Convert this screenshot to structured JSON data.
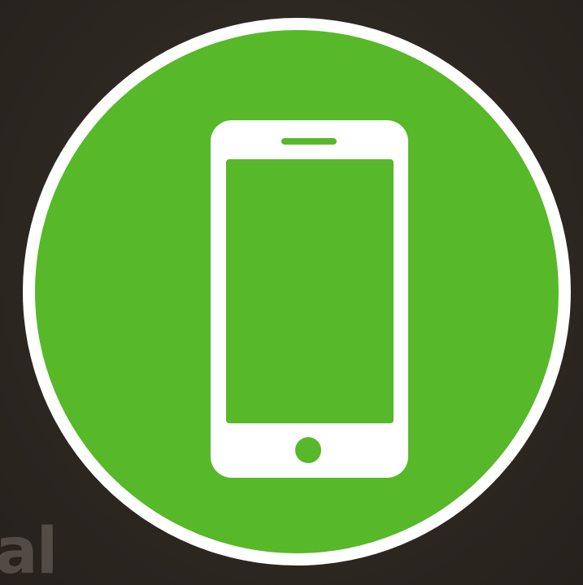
{
  "icon": {
    "name": "smartphone-icon",
    "circle_color": "#57b82a",
    "ring_color": "#ffffff",
    "phone_color": "#ffffff",
    "background_color": "#2e2823"
  },
  "corner_fragment": {
    "text": "al"
  }
}
